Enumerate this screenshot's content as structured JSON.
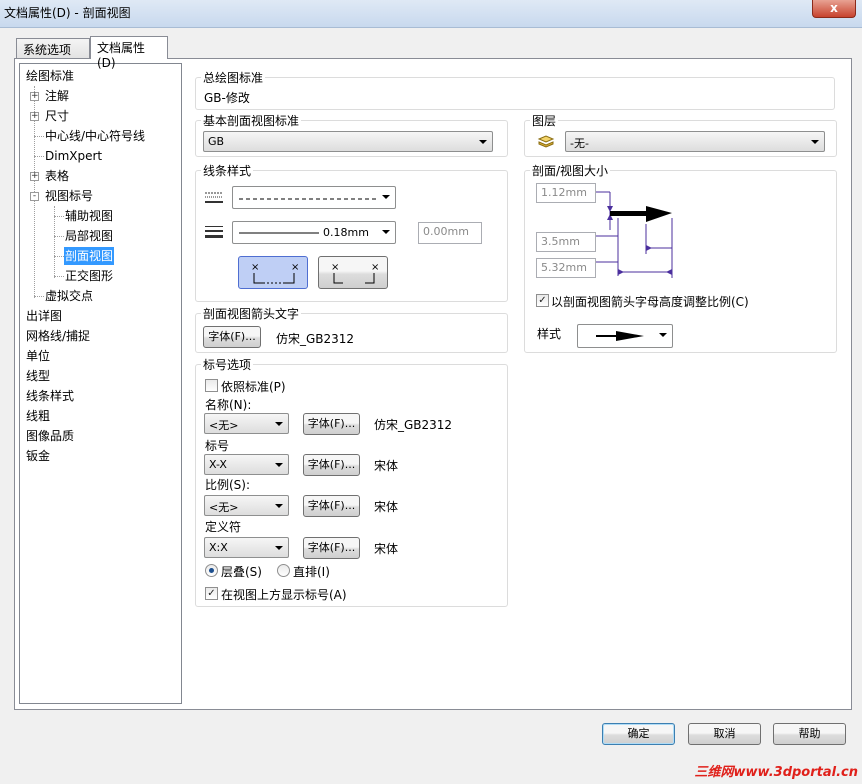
{
  "window": {
    "title": "文档属性(D) - 剖面视图",
    "close": "x"
  },
  "tabs": [
    "系统选项(S)",
    "文档属性(D)"
  ],
  "tree": {
    "items": [
      "绘图标准",
      "注解",
      "尺寸",
      "中心线/中心符号线",
      "DimXpert",
      "表格",
      "视图标号",
      "辅助视图",
      "局部视图",
      "剖面视图",
      "正交图形",
      "虚拟交点",
      "出详图",
      "网格线/捕捉",
      "单位",
      "线型",
      "线条样式",
      "线粗",
      "图像品质",
      "钣金"
    ],
    "expanders": [
      "+",
      "+",
      "+",
      "-"
    ]
  },
  "overall": {
    "label": "总绘图标准",
    "value": "GB-修改"
  },
  "base_standard": {
    "label": "基本剖面视图标准",
    "value": "GB"
  },
  "layer": {
    "label": "图层",
    "value": "-无-"
  },
  "line_style": {
    "label": "线条样式",
    "thickness": "0.18mm",
    "custom_width": "0.00mm"
  },
  "size": {
    "label": "剖面/视图大小",
    "v1": "1.12mm",
    "v2": "3.5mm",
    "v3": "5.32mm",
    "scale_label": "以剖面视图箭头字母高度调整比例(C)",
    "style_label": "样式"
  },
  "arrow_text": {
    "label": "剖面视图箭头文字",
    "font_button": "字体(F)...",
    "font_name": "仿宋_GB2312"
  },
  "label_options": {
    "label": "标号选项",
    "per_standard": "依照标准(P)",
    "name_label": "名称(N):",
    "name_value": "<无>",
    "name_font": "仿宋_GB2312",
    "mark_label": "标号",
    "mark_value": "X-X",
    "mark_font": "宋体",
    "scale_label": "比例(S):",
    "scale_value": "<无>",
    "scale_font": "宋体",
    "delim_label": "定义符",
    "delim_value": "X:X",
    "delim_font": "宋体",
    "font_button": "字体(F)...",
    "stacked": "层叠(S)",
    "inline": "直排(I)",
    "show_above": "在视图上方显示标号(A)"
  },
  "buttons": {
    "ok": "确定",
    "cancel": "取消",
    "help": "帮助"
  },
  "watermark": "三维网www.3dportal.cn"
}
